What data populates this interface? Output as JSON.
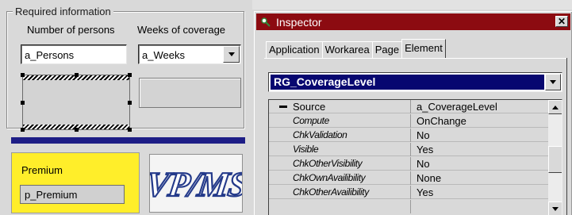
{
  "form": {
    "group_title": "Required information",
    "col_persons_label": "Number of persons",
    "col_weeks_label": "Weeks of coverage",
    "persons_value": "a_Persons",
    "weeks_value": "a_Weeks",
    "premium_label": "Premium",
    "premium_value": "p_Premium",
    "logo_text": "VP/MS"
  },
  "inspector": {
    "title": "Inspector",
    "tabs": [
      {
        "label": "Application"
      },
      {
        "label": "Workarea"
      },
      {
        "label": "Page"
      },
      {
        "label": "Element",
        "active": true
      }
    ],
    "selected_object": "RG_CoverageLevel",
    "properties": [
      {
        "name": "Source",
        "value": "a_CoverageLevel",
        "group": true
      },
      {
        "name": "Compute",
        "value": "OnChange"
      },
      {
        "name": "ChkValidation",
        "value": "No"
      },
      {
        "name": "Visible",
        "value": "Yes"
      },
      {
        "name": "ChkOtherVisibility",
        "value": "No"
      },
      {
        "name": "ChkOwnAvailibility",
        "value": "None"
      },
      {
        "name": "ChkOtherAvailibility",
        "value": "Yes"
      }
    ]
  },
  "colors": {
    "titlebar": "#8c0b11",
    "selection": "#070770",
    "premium_bg": "#ffee2a",
    "divider_bar": "#1d1d86"
  }
}
